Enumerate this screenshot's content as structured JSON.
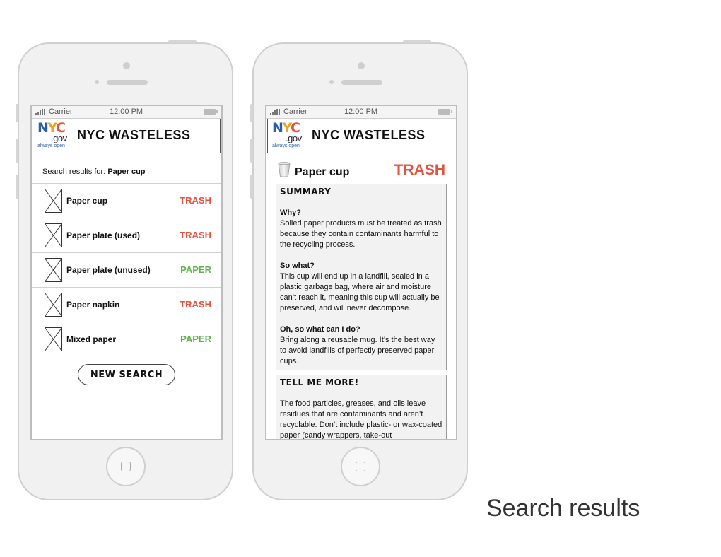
{
  "status_bar": {
    "carrier": "Carrier",
    "time": "12:00 PM"
  },
  "app": {
    "title": "NYC WASTELESS",
    "logo": {
      "mark": "NYC",
      "suffix": ".gov",
      "tagline": "always open"
    }
  },
  "colors": {
    "trash": "#e5533f",
    "paper": "#5db44a",
    "logo_n": "#2a5fa8",
    "logo_y": "#f2a21f",
    "logo_c": "#e5533f"
  },
  "results_screen": {
    "search_prefix": "Search results for: ",
    "query": "Paper cup",
    "results": [
      {
        "name": "Paper cup",
        "category": "TRASH"
      },
      {
        "name": "Paper plate (used)",
        "category": "TRASH"
      },
      {
        "name": "Paper plate (unused)",
        "category": "PAPER"
      },
      {
        "name": "Paper napkin",
        "category": "TRASH"
      },
      {
        "name": "Mixed paper",
        "category": "PAPER"
      }
    ],
    "new_search_label": "NEW SEARCH"
  },
  "detail_screen": {
    "item_icon": "cup-icon",
    "item_name": "Paper cup",
    "category": "TRASH",
    "summary": {
      "title": "SUMMARY",
      "sections": [
        {
          "q": "Why?",
          "a": "Soiled paper products must be treated as trash because they contain contaminants harmful to the recycling process."
        },
        {
          "q": "So what?",
          "a": "This cup will end up in a landfill, sealed in a plastic garbage bag, where air and moisture can’t reach it, meaning this cup will actually be preserved, and will never decompose."
        },
        {
          "q": "Oh, so what can I do?",
          "a": "Bring along a reusable mug. It’s the best way to avoid landfills of perfectly preserved paper cups."
        }
      ]
    },
    "more": {
      "title": "TELL ME MORE!",
      "text": "The food particles, greases, and oils leave residues that are contaminants and aren’t recyclable. Don’t include plastic- or wax-coated paper (candy wrappers, take-out"
    }
  },
  "caption": "Search results"
}
